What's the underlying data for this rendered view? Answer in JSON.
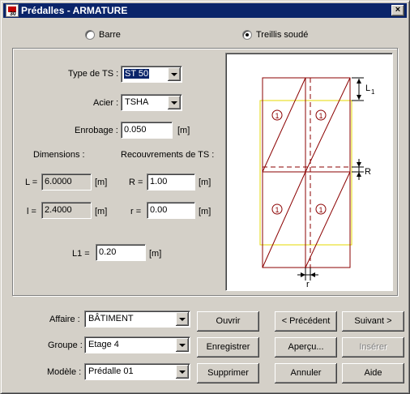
{
  "window": {
    "title": "Prédalles - ARMATURE",
    "close_label": "×"
  },
  "mode": {
    "options": [
      {
        "label": "Barre",
        "selected": false
      },
      {
        "label": "Treillis soudé",
        "selected": true
      }
    ]
  },
  "form": {
    "type_ts_label": "Type de TS :",
    "type_ts_value": "ST 50",
    "acier_label": "Acier :",
    "acier_value": "TSHA",
    "enrobage_label": "Enrobage :",
    "enrobage_value": "0.050",
    "enrobage_unit": "[m]",
    "dimensions_label": "Dimensions :",
    "recouvrements_label": "Recouvrements de TS :",
    "L_label": "L =",
    "L_value": "6.0000",
    "L_unit": "[m]",
    "l_label": "l =",
    "l_value": "2.4000",
    "l_unit": "[m]",
    "R_label": "R =",
    "R_value": "1.00",
    "R_unit": "[m]",
    "r_label": "r =",
    "r_value": "0.00",
    "r_unit": "[m]",
    "L1_label": "L1 =",
    "L1_value": "0.20",
    "L1_unit": "[m]"
  },
  "diagram": {
    "panel_number": "1",
    "L1_label": "L",
    "L1_sub": "1",
    "R_label": "R",
    "r_label": "r",
    "colors": {
      "panel": "#8b0000",
      "outline": "#e6d800",
      "dim": "#000000"
    }
  },
  "bottom": {
    "affaire_label": "Affaire :",
    "affaire_value": "BÂTIMENT",
    "groupe_label": "Groupe :",
    "groupe_value": "Etage 4",
    "modele_label": "Modèle :",
    "modele_value": "Prédalle 01",
    "buttons": {
      "ouvrir": "Ouvrir",
      "enregistrer": "Enregistrer",
      "supprimer": "Supprimer",
      "precedent": "< Précédent",
      "suivant": "Suivant >",
      "apercu": "Aperçu...",
      "inserer": "Insérer",
      "annuler": "Annuler",
      "aide": "Aide"
    }
  }
}
